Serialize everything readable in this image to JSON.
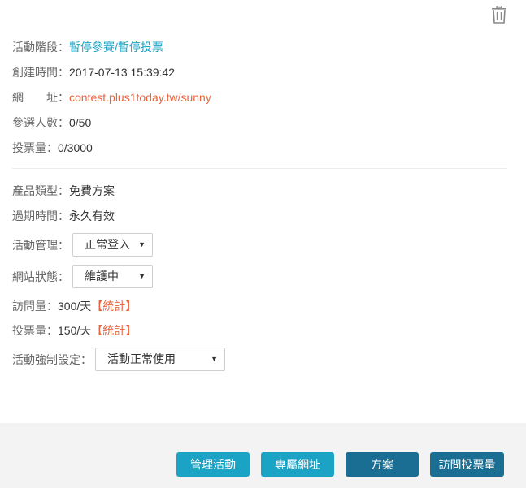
{
  "activity": {
    "stage_label": "活動階段：",
    "stage_value": "暫停參賽/暫停投票",
    "created_label": "創建時間：",
    "created_value": "2017-07-13 15:39:42",
    "url_label": "網　　址：",
    "url_value": "contest.plus1today.tw/sunny",
    "participants_label": "參選人數：",
    "participants_value": "0/50",
    "votes_label": "投票量：",
    "votes_value": "0/3000"
  },
  "product": {
    "type_label": "產品類型：",
    "type_value": "免費方案",
    "expiry_label": "過期時間：",
    "expiry_value": "永久有效",
    "manage_label": "活動管理：",
    "manage_selected": "正常登入",
    "site_status_label": "網站狀態：",
    "site_status_selected": "維護中",
    "visits_label": "訪問量：",
    "visits_value": "300/天",
    "visits_stat": "【統計】",
    "daily_votes_label": "投票量：",
    "daily_votes_value": "150/天",
    "daily_votes_stat": "【統計】",
    "force_label": "活動強制設定：",
    "force_selected": "活動正常使用"
  },
  "footer": {
    "manage_button": "管理活動",
    "url_button": "專屬網址",
    "plan_button": "方案",
    "visit_votes_button": "訪問投票量"
  },
  "colors": {
    "accent_teal": "#1aa3c4",
    "accent_dark": "#1a6e93",
    "link_orange": "#e8643c"
  },
  "icons": {
    "trash": "trash-icon",
    "select_arrow": "caret-down-icon"
  }
}
